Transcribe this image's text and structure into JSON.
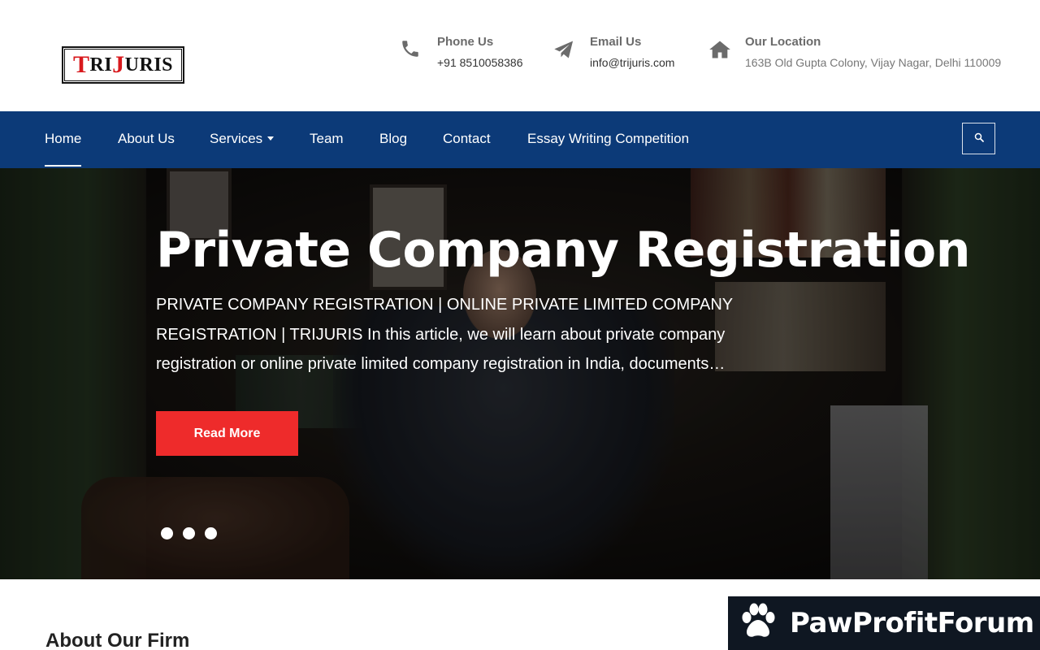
{
  "logo": {
    "part1": "T",
    "part2": "RI",
    "part3": "J",
    "part4": "URIS"
  },
  "contacts": [
    {
      "title": "Phone Us",
      "value": "+91 8510058386",
      "icon": "phone-icon"
    },
    {
      "title": "Email Us",
      "value": "info@trijuris.com",
      "icon": "paper-plane-icon"
    },
    {
      "title": "Our Location",
      "value": "163B Old Gupta Colony, Vijay Nagar, Delhi 110009",
      "icon": "home-icon"
    }
  ],
  "nav": {
    "items": [
      {
        "label": "Home",
        "active": true
      },
      {
        "label": "About Us"
      },
      {
        "label": "Services",
        "dropdown": true
      },
      {
        "label": "Team"
      },
      {
        "label": "Blog"
      },
      {
        "label": "Contact"
      },
      {
        "label": "Essay Writing Competition"
      }
    ],
    "search_icon": "search-icon"
  },
  "hero": {
    "title": "Private Company Registration",
    "description": "PRIVATE COMPANY REGISTRATION | ONLINE PRIVATE LIMITED COMPANY REGISTRATION | TRIJURIS In this article, we will learn about private company registration or online private limited company registration in India, documents…",
    "button": "Read More",
    "slides": 3
  },
  "about": {
    "title": "About Our Firm"
  },
  "watermark": {
    "text": "PawProfitForum",
    "icon": "paw-icon"
  },
  "colors": {
    "navbar": "#0c3a78",
    "accent": "#ee2b2b",
    "icon_gray": "#6b6b6b"
  }
}
